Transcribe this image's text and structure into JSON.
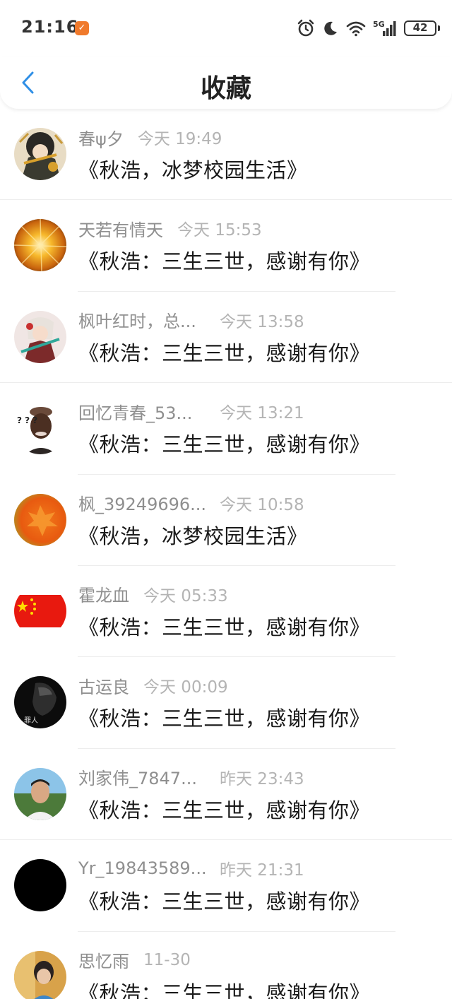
{
  "status_bar": {
    "time": "21:16",
    "app_badge": "✓",
    "network": "5G",
    "battery": "42"
  },
  "header": {
    "title": "收藏",
    "accent_color": "#2f8fe6"
  },
  "items": [
    {
      "user": "春ψ夕",
      "time": "今天 19:49",
      "title": "《秋浩，冰梦校园生活》"
    },
    {
      "user": "天若有情天",
      "time": "今天 15:53",
      "title": "《秋浩：三生三世，感谢有你》"
    },
    {
      "user": "枫叶红时，总...",
      "time": "今天 13:58",
      "title": "《秋浩：三生三世，感谢有你》"
    },
    {
      "user": "回忆青春_53...",
      "time": "今天 13:21",
      "title": "《秋浩：三生三世，感谢有你》"
    },
    {
      "user": "枫_39249696...",
      "time": "今天 10:58",
      "title": "《秋浩，冰梦校园生活》"
    },
    {
      "user": "霍龙血",
      "time": "今天 05:33",
      "title": "《秋浩：三生三世，感谢有你》"
    },
    {
      "user": "古运良",
      "time": "今天 00:09",
      "title": "《秋浩：三生三世，感谢有你》"
    },
    {
      "user": "刘家伟_7847...",
      "time": "昨天 23:43",
      "title": "《秋浩：三生三世，感谢有你》"
    },
    {
      "user": "Yr_19843589...",
      "time": "昨天 21:31",
      "title": "《秋浩：三生三世，感谢有你》"
    },
    {
      "user": "思忆雨",
      "time": "11-30",
      "title": "《秋浩：三生三世，感谢有你》"
    }
  ],
  "avatar_texts": {
    "question_marks": "? ? ?",
    "dark_avatar_caption": "罪人"
  }
}
